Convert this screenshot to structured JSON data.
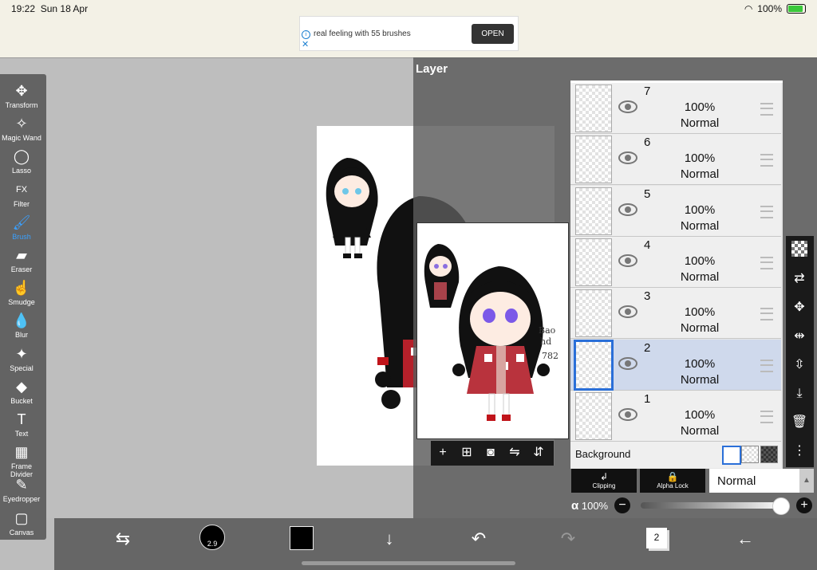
{
  "status": {
    "time": "19:22",
    "date": "Sun 18 Apr",
    "battery": "100%"
  },
  "ad": {
    "text": "real feeling with 55 brushes",
    "button": "OPEN"
  },
  "tools": [
    {
      "label": "Transform",
      "icon": "move-icon"
    },
    {
      "label": "Magic Wand",
      "icon": "magic-wand-icon"
    },
    {
      "label": "Lasso",
      "icon": "lasso-icon"
    },
    {
      "label": "Filter",
      "icon": "fx-icon"
    },
    {
      "label": "Brush",
      "icon": "brush-icon",
      "active": true
    },
    {
      "label": "Eraser",
      "icon": "eraser-icon"
    },
    {
      "label": "Smudge",
      "icon": "smudge-icon"
    },
    {
      "label": "Blur",
      "icon": "blur-drop-icon"
    },
    {
      "label": "Special",
      "icon": "sparkle-icon"
    },
    {
      "label": "Bucket",
      "icon": "bucket-icon"
    },
    {
      "label": "Text",
      "icon": "text-icon"
    },
    {
      "label": "Frame Divider",
      "icon": "frame-divider-icon"
    },
    {
      "label": "Eyedropper",
      "icon": "eyedropper-icon"
    },
    {
      "label": "Canvas",
      "icon": "canvas-icon"
    }
  ],
  "layer_panel": {
    "title": "Layer",
    "layers": [
      {
        "num": "7",
        "opacity": "100%",
        "mode": "Normal"
      },
      {
        "num": "6",
        "opacity": "100%",
        "mode": "Normal"
      },
      {
        "num": "5",
        "opacity": "100%",
        "mode": "Normal"
      },
      {
        "num": "4",
        "opacity": "100%",
        "mode": "Normal"
      },
      {
        "num": "3",
        "opacity": "100%",
        "mode": "Normal"
      },
      {
        "num": "2",
        "opacity": "100%",
        "mode": "Normal",
        "selected": true
      },
      {
        "num": "1",
        "opacity": "100%",
        "mode": "Normal"
      }
    ],
    "background_label": "Background",
    "clipping_label": "Clipping",
    "alpha_lock_label": "Alpha Lock",
    "blend_mode": "Normal",
    "alpha_symbol": "α",
    "opacity": "100%",
    "opacity_value": 100
  },
  "bottom": {
    "brush_size": "2.9",
    "layer_count": "2",
    "color": "#000000"
  }
}
